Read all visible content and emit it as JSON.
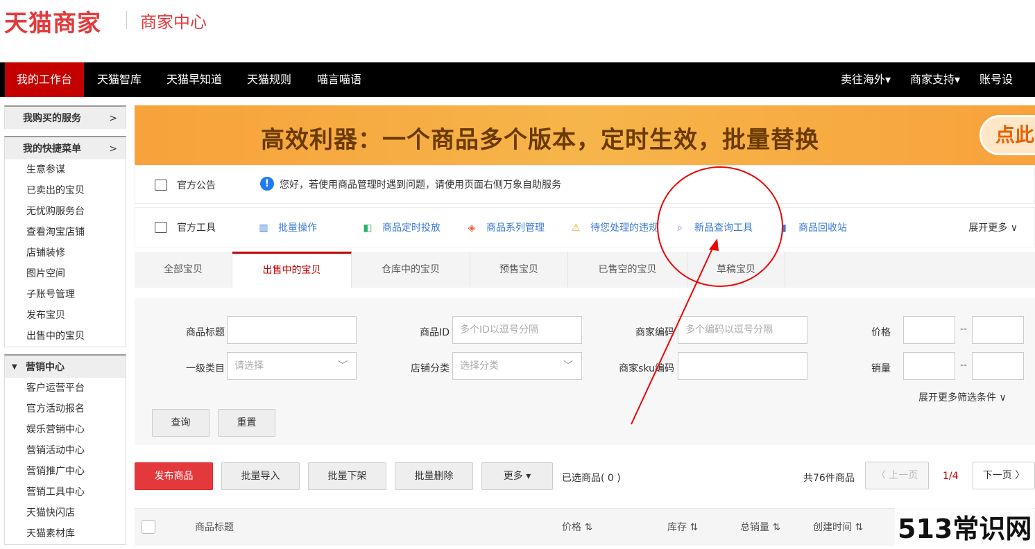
{
  "header": {
    "logo": "天猫商家",
    "subtitle": "商家中心"
  },
  "nav": {
    "left": [
      "我的工作台",
      "天猫智库",
      "天猫早知道",
      "天猫规则",
      "喵言喵语"
    ],
    "right": [
      "卖往海外▾",
      "商家支持▾",
      "账号设置"
    ]
  },
  "sidebar": {
    "purchased": "我购买的服务",
    "quick_menu": "我的快捷菜单",
    "quick_items": [
      "生意参谋",
      "已卖出的宝贝",
      "无忧购服务台",
      "查看淘宝店铺",
      "店铺装修",
      "图片空间",
      "子账号管理",
      "发布宝贝",
      "出售中的宝贝"
    ],
    "marketing": "营销中心",
    "marketing_items": [
      "客户运营平台",
      "官方活动报名",
      "娱乐营销中心",
      "营销活动中心",
      "营销推广中心",
      "营销工具中心",
      "天猫快闪店",
      "天猫素材库"
    ],
    "chevron": ">"
  },
  "banner": {
    "text": "高效利器：一个商品多个版本，定时生效，批量替换",
    "button": "点此"
  },
  "notice": {
    "title": "官方公告",
    "text": "您好，若使用商品管理时遇到问题，请使用页面右侧万象自助服务"
  },
  "tools": {
    "title": "官方工具",
    "items": [
      "批量操作",
      "商品定时投放",
      "商品系列管理",
      "待您处理的违规",
      "新品查询工具",
      "商品回收站"
    ],
    "more": "展开更多 ∨"
  },
  "tabs": [
    "全部宝贝",
    "出售中的宝贝",
    "仓库中的宝贝",
    "预售宝贝",
    "已售空的宝贝",
    "草稿宝贝"
  ],
  "filters": {
    "title_label": "商品标题",
    "id_label": "商品ID",
    "id_placeholder": "多个ID以逗号分隔",
    "code_label": "商家编码",
    "code_placeholder": "多个编码以逗号分隔",
    "price_label": "价格",
    "category_label": "一级类目",
    "category_placeholder": "请选择",
    "shopcat_label": "店铺分类",
    "shopcat_placeholder": "选择分类",
    "sku_label": "商家sku编码",
    "sales_label": "销量",
    "dash": "--",
    "more": "展开更多筛选条件 ∨",
    "search": "查询",
    "reset": "重置"
  },
  "actions": {
    "publish": "发布商品",
    "import": "批量导入",
    "delist": "批量下架",
    "delete": "批量删除",
    "more": "更多 ▾",
    "selected": "已选商品( 0 )",
    "total": "共76件商品",
    "prev": "〈 上一页",
    "page": "1/4",
    "next": "下一页 〉"
  },
  "table": {
    "headers": [
      "商品标题",
      "价格 ⇅",
      "库存 ⇅",
      "总销量 ⇅",
      "创建时间 ⇅"
    ]
  },
  "watermark": "513常识网"
}
